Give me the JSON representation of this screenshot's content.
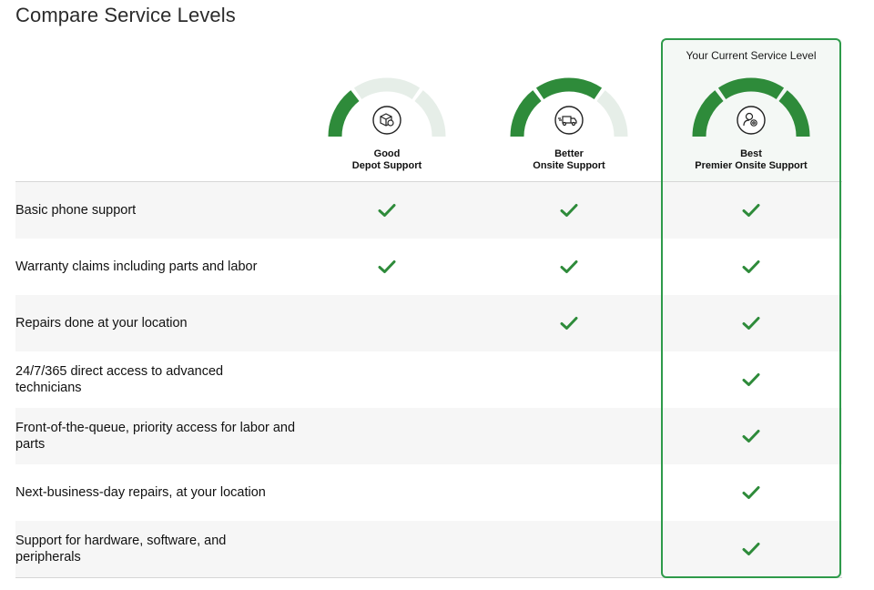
{
  "page": {
    "title": "Compare Service Levels"
  },
  "current_label": "Your Current Service Level",
  "colors": {
    "accent": "#2e8b3a",
    "gauge_inactive": "#e6eee8",
    "border": "#2e9a4a"
  },
  "tiers": [
    {
      "level": "Good",
      "name": "Depot Support",
      "icon": "package-repair-icon",
      "active_segments": 1
    },
    {
      "level": "Better",
      "name": "Onsite Support",
      "icon": "delivery-truck-icon",
      "active_segments": 2
    },
    {
      "level": "Best",
      "name": "Premier Onsite Support",
      "icon": "technician-support-icon",
      "active_segments": 3
    }
  ],
  "features": [
    {
      "label": "Basic phone support",
      "included": [
        true,
        true,
        true
      ]
    },
    {
      "label": "Warranty claims including parts and labor",
      "included": [
        true,
        true,
        true
      ]
    },
    {
      "label": "Repairs done at your location",
      "included": [
        false,
        true,
        true
      ]
    },
    {
      "label": "24/7/365 direct access to advanced technicians",
      "included": [
        false,
        false,
        true
      ]
    },
    {
      "label": "Front-of-the-queue, priority access for labor and parts",
      "included": [
        false,
        false,
        true
      ]
    },
    {
      "label": "Next-business-day repairs, at your location",
      "included": [
        false,
        false,
        true
      ]
    },
    {
      "label": "Support for hardware, software, and peripherals",
      "included": [
        false,
        false,
        true
      ]
    }
  ]
}
